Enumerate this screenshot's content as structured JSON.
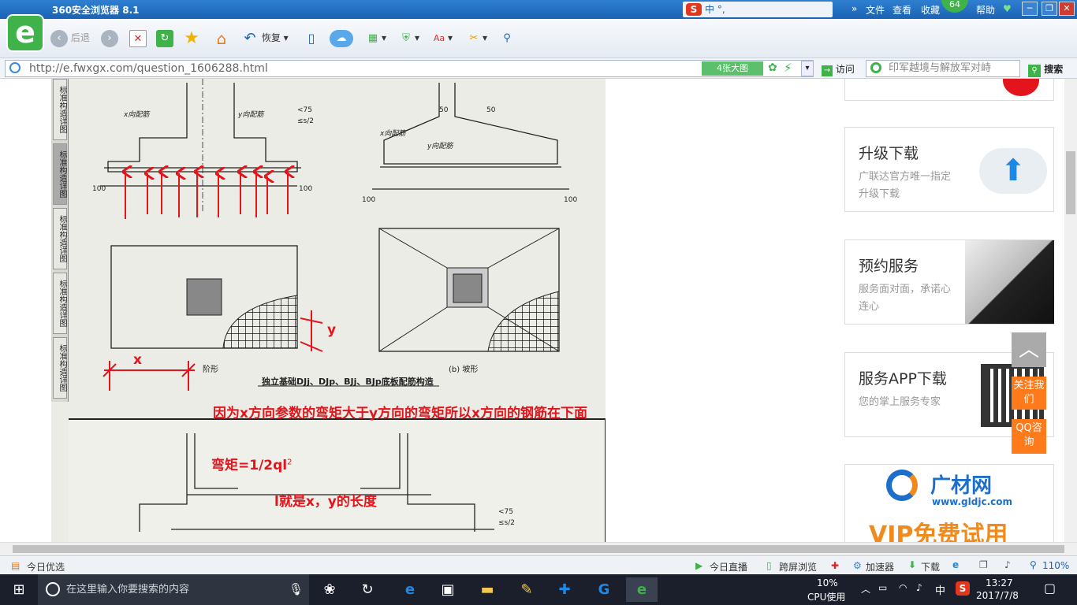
{
  "browser": {
    "title": "360安全浏览器 8.1",
    "menu": [
      "文件",
      "查看",
      "收藏",
      "帮助"
    ],
    "badge": "64",
    "ime": "中 °, ",
    "toolbar": {
      "back": "后退",
      "restore": "恢复"
    },
    "url": "http://e.fwxgx.com/question_1606288.html",
    "big_image": "4张大图",
    "visit": "访问",
    "search_placeholder": "印军越境与解放军对峙",
    "search_button": "搜索"
  },
  "page": {
    "tabs": [
      "标准构造详图",
      "标准构造详图",
      "标准构造详图",
      "标准构造详图",
      "标准构造详图"
    ],
    "drawing_caption": "独立基础DJj、DJp、BJj、BJp底板配筋构造",
    "label_a": "阶形",
    "label_b": "(b) 坡形",
    "axis_x": "x",
    "axis_y": "y",
    "dim_100": "100",
    "dim_50": "50",
    "dim_75": "<75",
    "dim_s2": "≤s/2",
    "rebar_x": "x向配筋",
    "rebar_y": "y向配筋",
    "annotation_main": "因为x方向参数的弯矩大于y方向的弯矩所以x方向的钢筋在下面",
    "annotation_formula": "弯矩=1/2ql",
    "annotation_sup": "2",
    "annotation_l": "l就是x，y的长度"
  },
  "sidebar": {
    "cards": [
      {
        "title": "升级下载",
        "desc": "广联达官方唯一指定升级下载"
      },
      {
        "title": "预约服务",
        "desc": "服务面对面，承诺心连心"
      },
      {
        "title": "服务APP下载",
        "desc": "您的掌上服务专家"
      }
    ],
    "float_top": "︿",
    "float_follow": "关注我们",
    "float_qq": "QQ咨询",
    "ad_brand": "广材网",
    "ad_url": "www.gldjc.com",
    "ad_vip": "VIP免费试用"
  },
  "statusbar": {
    "left": "今日优选",
    "live": "今日直播",
    "cross": "跨屏浏览",
    "accel": "加速器",
    "download": "下载",
    "zoom": "110%"
  },
  "taskbar": {
    "search": "在这里输入你要搜索的内容",
    "cpu_pct": "10%",
    "cpu_label": "CPU使用",
    "lang": "中",
    "time": "13:27",
    "date": "2017/7/8"
  },
  "colors": {
    "accent": "#1b63b3",
    "annotation": "#e3141c",
    "brand_green": "#3fb24a"
  }
}
